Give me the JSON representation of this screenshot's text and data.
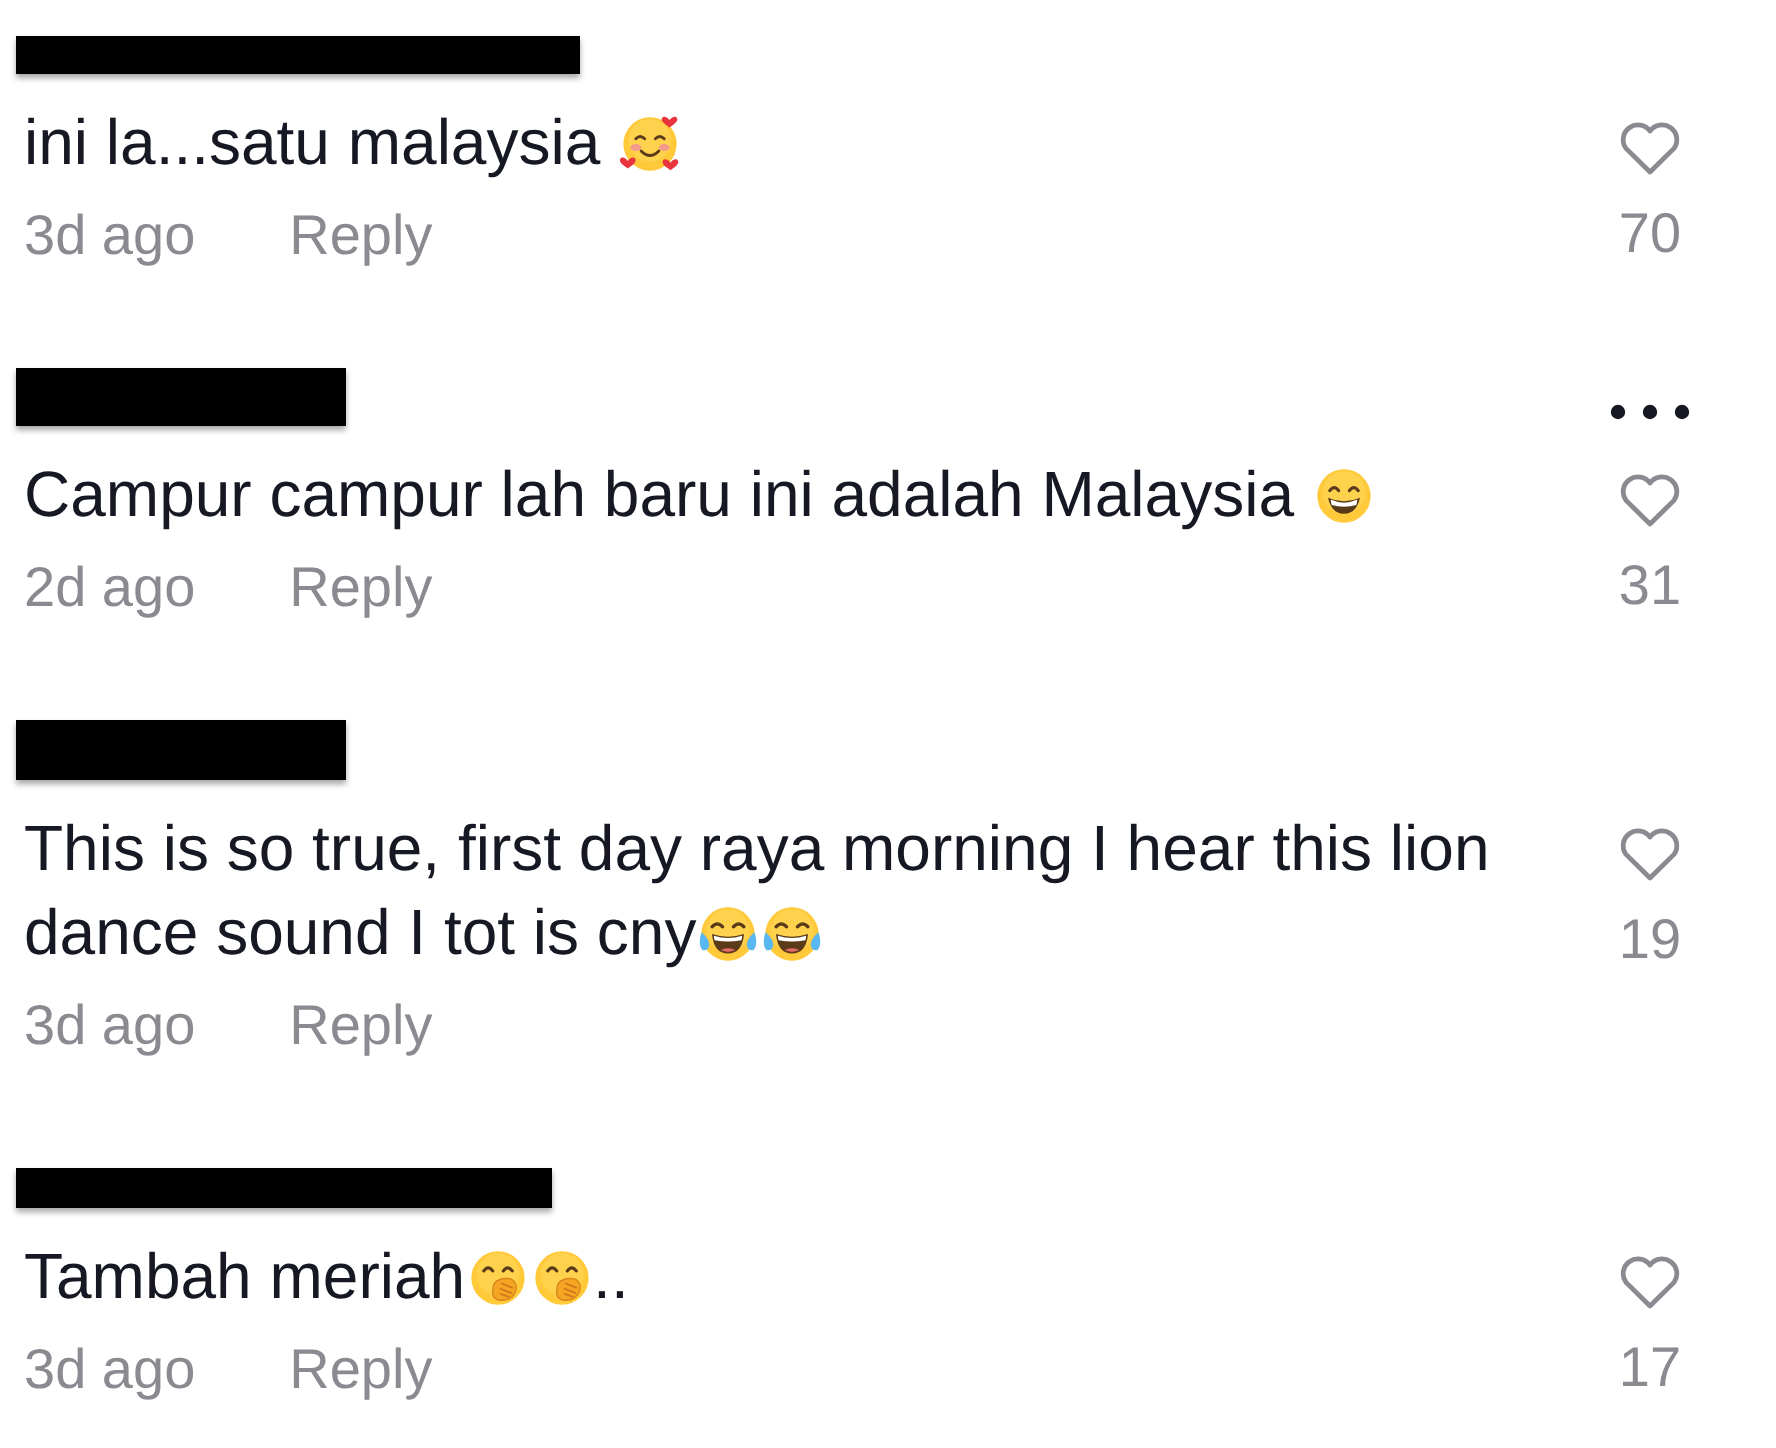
{
  "comments": [
    {
      "username_redacted": true,
      "lines": [
        [
          {
            "kind": "text",
            "text": "ini la...satu malaysia "
          },
          {
            "kind": "hearts"
          }
        ]
      ],
      "time": "3d ago",
      "reply": "Reply",
      "more": false,
      "liked": false,
      "likes": "70"
    },
    {
      "username_redacted": true,
      "lines": [
        [
          {
            "kind": "text",
            "text": "Campur campur lah baru ini adalah Malaysia "
          },
          {
            "kind": "grin"
          }
        ]
      ],
      "time": "2d ago",
      "reply": "Reply",
      "more": true,
      "liked": false,
      "likes": "31"
    },
    {
      "username_redacted": true,
      "lines": [
        [
          {
            "kind": "text",
            "text": "This is so true, first day raya morning I hear this lion"
          }
        ],
        [
          {
            "kind": "text",
            "text": "dance sound I tot is cny"
          },
          {
            "kind": "tears"
          },
          {
            "kind": "tears"
          }
        ]
      ],
      "time": "3d ago",
      "reply": "Reply",
      "more": false,
      "liked": false,
      "likes": "19"
    },
    {
      "username_redacted": true,
      "lines": [
        [
          {
            "kind": "text",
            "text": "Tambah meriah"
          },
          {
            "kind": "giggle"
          },
          {
            "kind": "giggle"
          },
          {
            "kind": "text",
            "text": ".."
          }
        ]
      ],
      "time": "3d ago",
      "reply": "Reply",
      "more": false,
      "liked": false,
      "likes": "17"
    }
  ]
}
